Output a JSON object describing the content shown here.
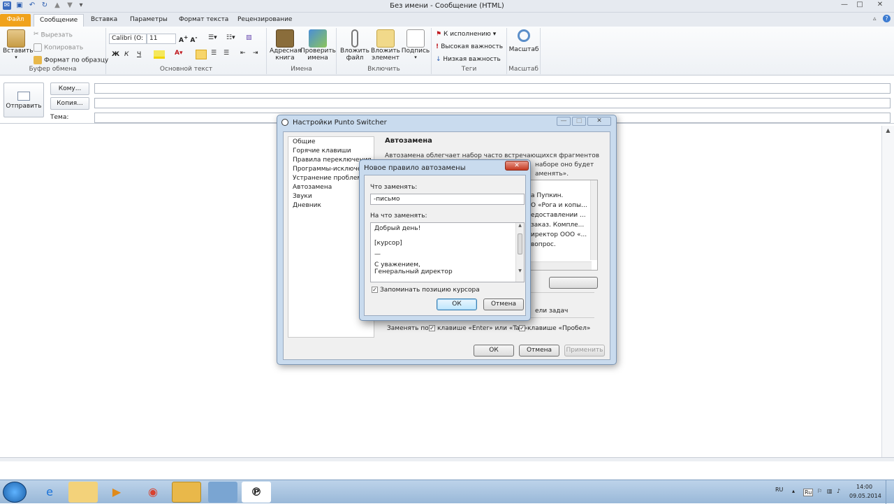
{
  "window": {
    "title": "Без имени  -  Сообщение (HTML)"
  },
  "quick_access": {
    "icons": [
      "save-icon",
      "undo-icon",
      "redo-icon",
      "up-arrow-icon",
      "down-arrow-icon"
    ]
  },
  "tabs": [
    "Файл",
    "Сообщение",
    "Вставка",
    "Параметры",
    "Формат текста",
    "Рецензирование"
  ],
  "ribbon": {
    "clipboard": {
      "paste": "Вставить",
      "cut": "Вырезать",
      "copy": "Копировать",
      "format_painter": "Формат по образцу",
      "label": "Буфер обмена"
    },
    "font": {
      "font_name": "Calibri (O:",
      "font_size": "11",
      "label": "Основной текст",
      "bold": "Ж",
      "italic": "К",
      "underline": "Ч"
    },
    "names": {
      "address_book_1": "Адресная",
      "address_book_2": "книга",
      "check_names_1": "Проверить",
      "check_names_2": "имена",
      "label": "Имена"
    },
    "include": {
      "attach_file_1": "Вложить",
      "attach_file_2": "файл",
      "attach_item_1": "Вложить",
      "attach_item_2": "элемент",
      "signature": "Подпись",
      "label": "Включить"
    },
    "tags": {
      "follow_up": "К исполнению",
      "high": "Высокая важность",
      "low": "Низкая важность",
      "label": "Теги"
    },
    "zoom": {
      "zoom": "Масштаб",
      "label": "Масштаб"
    }
  },
  "message": {
    "send": "Отправить",
    "to": "Кому...",
    "cc": "Копия...",
    "subject": "Тема:"
  },
  "punto": {
    "title": "Настройки Punto Switcher",
    "tree": [
      "Общие",
      "Горячие клавиши",
      "Правила переключения",
      "Программы-исключения",
      "Устранение проблем",
      "Автозамена",
      "Звуки",
      "Дневник"
    ],
    "section_title": "Автозамена",
    "description_line1": "Автозамена облегчает набор часто встречающихся фрагментов текста.",
    "description_frag_right": "наборе оно будет",
    "description_frag_right2": "аменять».",
    "list_items": [
      "а Пупкин.",
      "О «Рога и копы...",
      "едоставлении ...",
      "заказ. Компле...",
      "иректор ООО «...",
      "вопрос."
    ],
    "task_frag": "ели задач",
    "replace_by": "Заменять по:",
    "enter_tab": "клавише «Enter» или «Tab»",
    "space": "клавише «Пробел»",
    "ok": "ОК",
    "cancel": "Отмена",
    "apply": "Применить"
  },
  "rule": {
    "title": "Новое правило автозамены",
    "what_label": "Что заменять:",
    "what_value": "-письмо",
    "with_label": "На что заменять:",
    "with_lines": [
      "Добрый день!",
      "",
      "[курсор]",
      "",
      "—",
      "С уважением,",
      "Генеральный директор"
    ],
    "remember": "Запоминать позицию курсора",
    "ok": "ОК",
    "cancel": "Отмена"
  },
  "taskbar": {
    "lang": "RU",
    "lang_small": "Ru",
    "time": "14:00",
    "date": "09.05.2014"
  }
}
